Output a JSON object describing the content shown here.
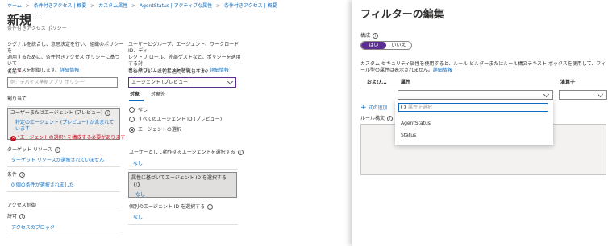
{
  "breadcrumb": [
    "ホーム",
    "条件付きアクセス | 概要",
    "カスタム属性",
    "AgentStatus | アクティブな属性",
    "条件付きアクセス | 概要"
  ],
  "breadcrumb_sep": ">",
  "page": {
    "title": "新規",
    "more": "…",
    "subtitle": "条件付きアクセス ポリシー"
  },
  "intro": {
    "text1": "シグナルを統合し、意思決定を行い、組織のポリシーを",
    "text2": "適用するために、条件付きアクセス ポリシーに基づいて",
    "text3": "アクセスを制御します。",
    "link": "詳細情報"
  },
  "name_field": {
    "label": "名前",
    "required": "*",
    "placeholder": "例: 'デバイス準拠アプリ ポリシー'"
  },
  "assign": {
    "header": "割り当て",
    "users": {
      "label": "ユーザーまたはエージェント (プレビュー)",
      "sub": "特定のエージェント (プレビュー) が含まれています",
      "error": "\"エージェントの選択\" を構成する必要があります"
    },
    "targets": {
      "label": "ターゲット リソース",
      "value": "ターゲット リソースが選択されていません"
    },
    "conditions": {
      "label": "条件",
      "value": "0 個の条件が選択されました"
    }
  },
  "access": {
    "header": "アクセス制御",
    "grant_label": "許可",
    "grant_value": "アクセスのブロック"
  },
  "mid": {
    "desc1": "ユーザーとグループ、エージェント、ワークロード ID、ディ",
    "desc2": "レクトリ ロール、外部ゲストなど、ポリシーを適用する対",
    "desc3": "象に基づいてアクセスを制御します。",
    "link": "詳細情報",
    "question": "このポリシーは何に適用されますか?",
    "dropdown_value": "エージェント (プレビュー)",
    "tabs": [
      "対象",
      "対象外"
    ],
    "radios": [
      "なし",
      "すべてのエージェント ID (プレビュー)",
      "エージェントの選択"
    ],
    "sec1": {
      "label": "ユーザーとして動作するエージェントを選択する",
      "value": "なし"
    },
    "sec2": {
      "label": "属性に基づいてエージェント ID を選択する",
      "value": "なし"
    },
    "sec3": {
      "label": "個別のエージェント ID を選択する",
      "value": "なし"
    }
  },
  "filter": {
    "title": "フィルターの編集",
    "config_label": "構成",
    "toggle": [
      "はい",
      "いいえ"
    ],
    "desc1": "カスタム セキュリティ属性を使用すると、ルール ビルダーまたはルール構文テキスト ボックスを使用して、フィルター ルールを作成",
    "desc2": "ール型の属性は表示されません。",
    "desc_link": "詳細情報",
    "columns": [
      "および...",
      "属性",
      "演算子"
    ],
    "add_expr": "式の追加",
    "rule_syntax": "ルール構文",
    "search_placeholder": "属性を選択",
    "options": [
      "AgentStatus",
      "Status"
    ]
  },
  "colors": {
    "accent": "#0f6cbd",
    "toggle": "#5c2e91",
    "error": "#c50f1f"
  }
}
